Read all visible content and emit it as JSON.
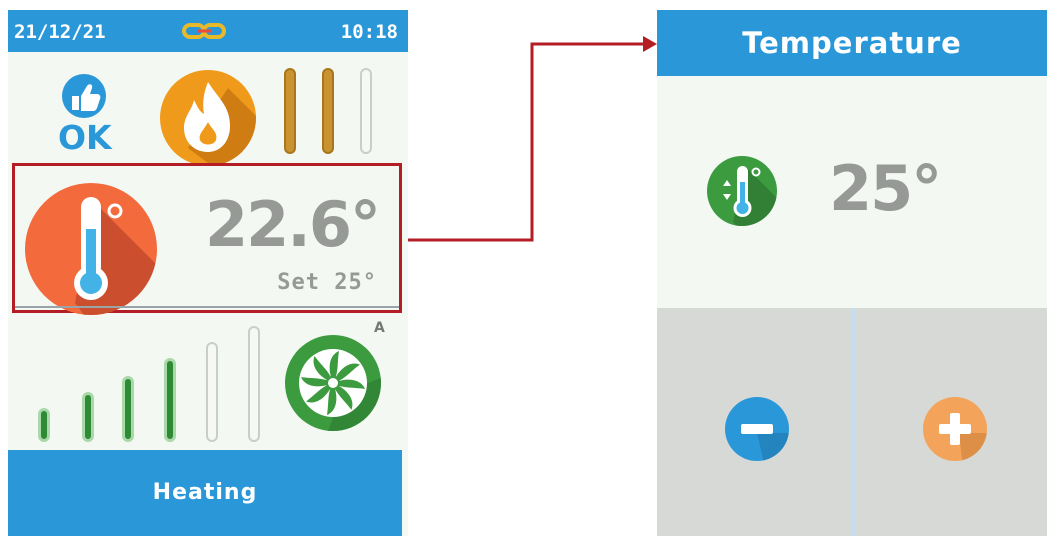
{
  "left_screen": {
    "status_bar": {
      "date": "21/12/21",
      "time": "10:18",
      "link_icon": "link-icon"
    },
    "ok_status": {
      "icon": "thumbs-up-icon",
      "label": "OK"
    },
    "flame_icon": "flame-icon",
    "burner_levels": {
      "filled": 2,
      "total": 3
    },
    "room_temperature": {
      "icon": "thermometer-icon",
      "current": "22.6°",
      "setpoint_label": "Set 25°"
    },
    "fan": {
      "icon": "fan-icon",
      "mode": "A",
      "speed_filled": 4,
      "speed_total": 6
    },
    "mode_bar": {
      "label": "Heating"
    }
  },
  "right_screen": {
    "title": "Temperature",
    "setpoint": {
      "icon": "thermometer-adjust-icon",
      "value": "25°"
    },
    "buttons": {
      "minus_icon": "minus-icon",
      "plus_icon": "plus-icon"
    }
  },
  "colors": {
    "accent_blue": "#2a98d8",
    "highlight_red": "#b41d24",
    "flame_orange": "#ef9a1a",
    "thermo_red": "#f36a3c",
    "fan_green": "#3c9b3f",
    "plus_orange": "#f3a45a",
    "text_gray": "#979997"
  }
}
